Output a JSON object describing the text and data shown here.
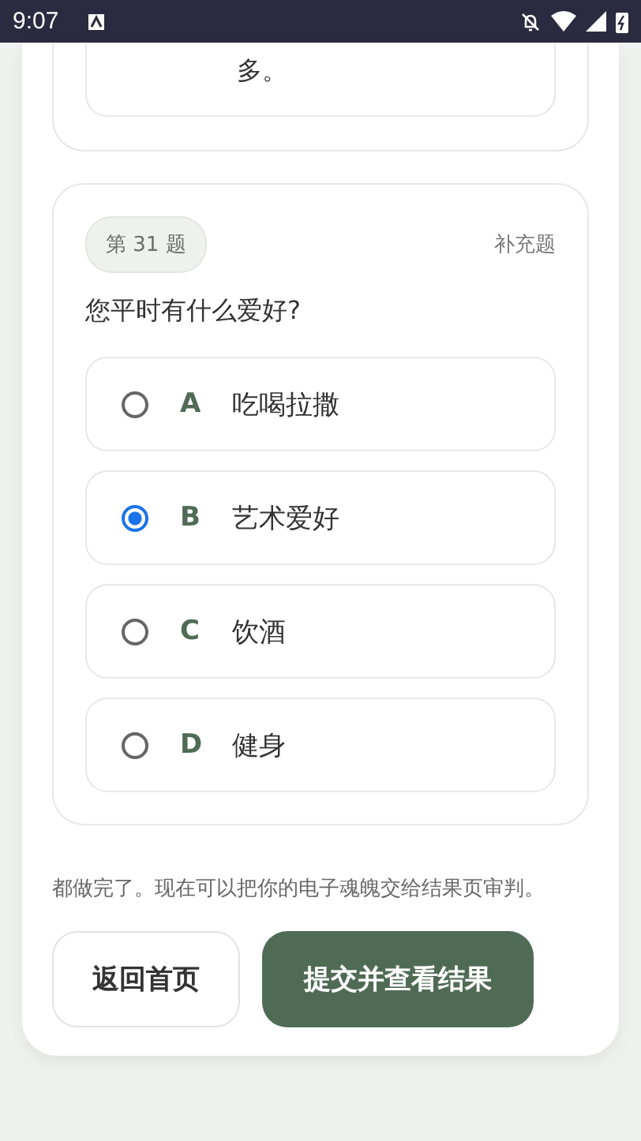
{
  "status_bar": {
    "time": "9:07"
  },
  "previous_question": {
    "option_text": "多。"
  },
  "question": {
    "badge": "第 31 题",
    "type": "补充题",
    "text": "您平时有什么爱好?",
    "options": [
      {
        "letter": "A",
        "text": "吃喝拉撒",
        "selected": false
      },
      {
        "letter": "B",
        "text": "艺术爱好",
        "selected": true
      },
      {
        "letter": "C",
        "text": "饮酒",
        "selected": false
      },
      {
        "letter": "D",
        "text": "健身",
        "selected": false
      }
    ]
  },
  "footer": {
    "message": "都做完了。现在可以把你的电子魂魄交给结果页审判。",
    "buttons": [
      {
        "label": "返回首页",
        "kind": "secondary"
      },
      {
        "label": "提交并查看结果",
        "kind": "primary"
      }
    ]
  }
}
